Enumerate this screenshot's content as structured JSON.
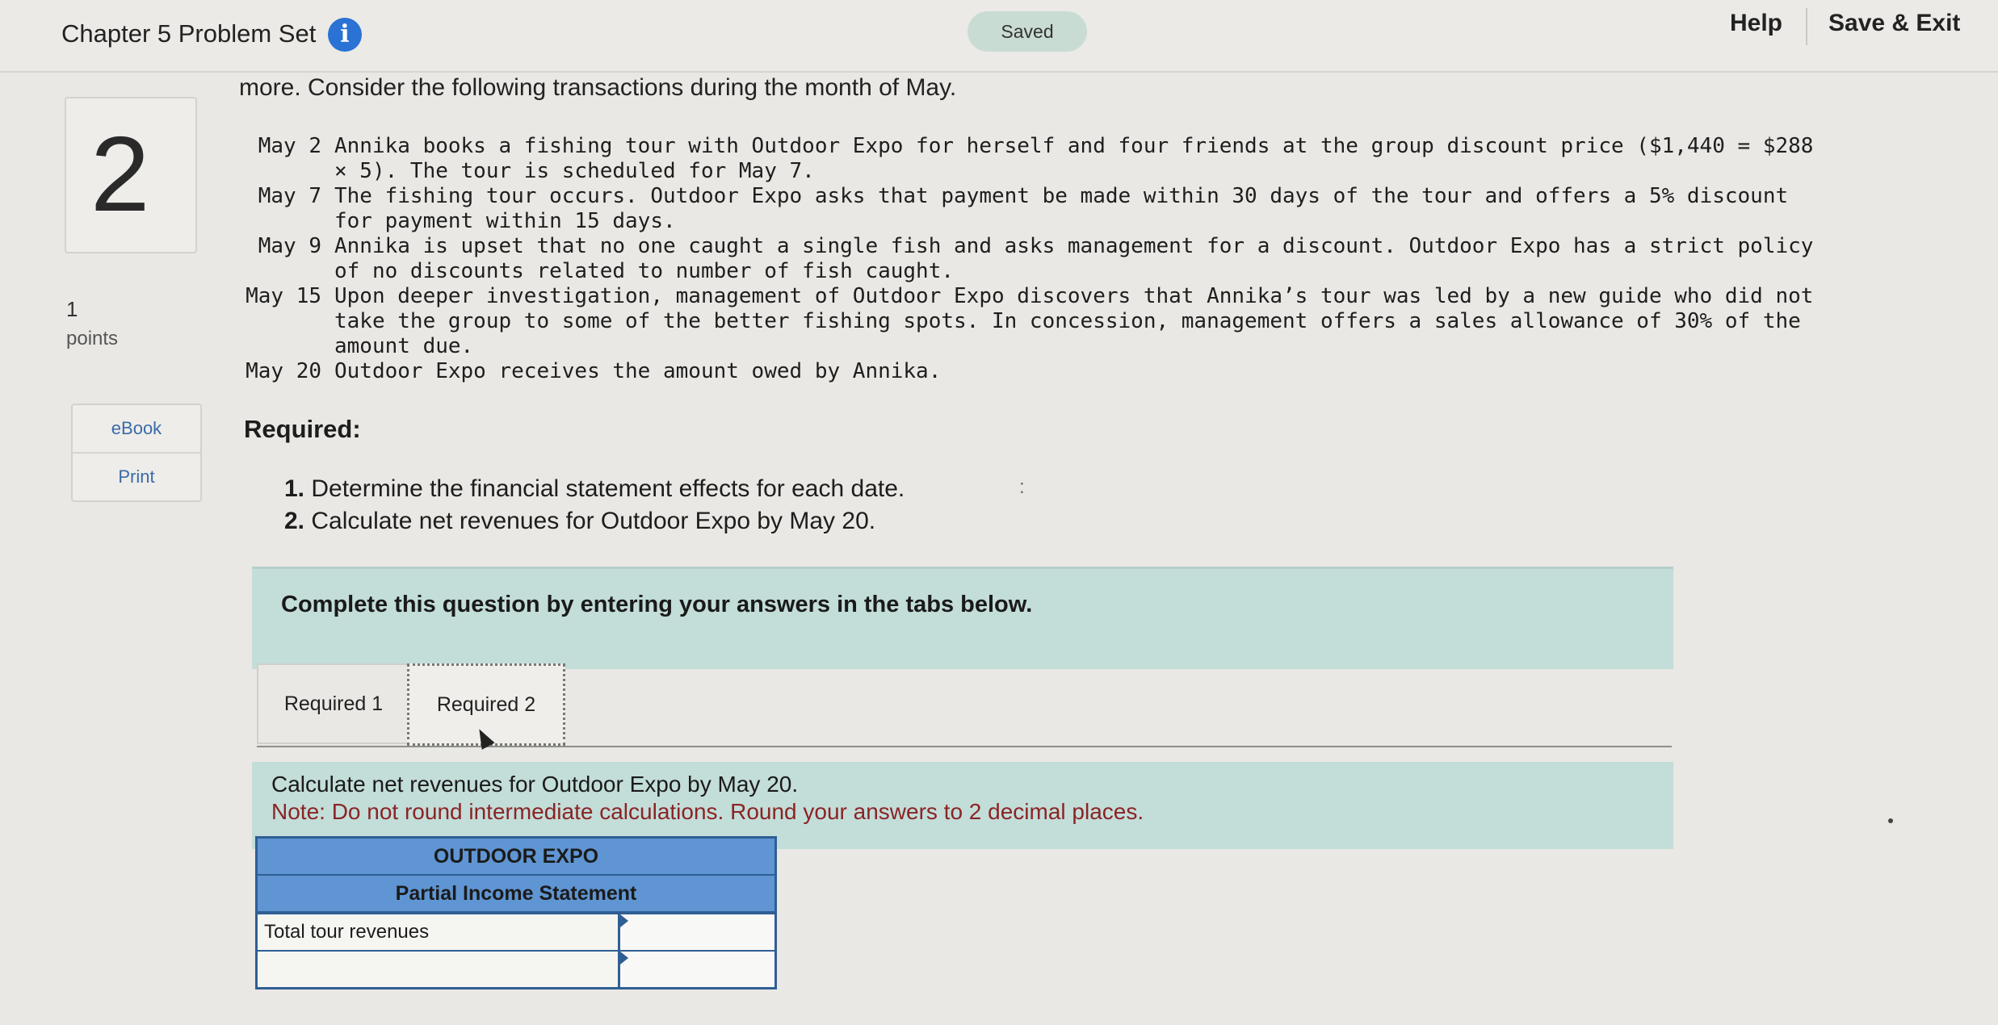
{
  "header": {
    "title": "Chapter 5 Problem Set",
    "info_icon": "i",
    "saved": "Saved",
    "help": "Help",
    "save_exit": "Save & Exit"
  },
  "sidebar": {
    "question_number": "2",
    "points_value": "1",
    "points_label": "points",
    "buttons": [
      "eBook",
      "Print"
    ]
  },
  "problem": {
    "intro": "more. Consider the following transactions during the month of May.",
    "transactions": [
      {
        "date": "May 2",
        "text": "Annika books a fishing tour with Outdoor Expo for herself and four friends at the group discount price ($1,440 = $288 × 5). The tour is scheduled for May 7."
      },
      {
        "date": "May 7",
        "text": "The fishing tour occurs. Outdoor Expo asks that payment be made within 30 days of the tour and offers a 5% discount for payment within 15 days."
      },
      {
        "date": "May 9",
        "text": "Annika is upset that no one caught a single fish and asks management for a discount. Outdoor Expo has a strict policy of no discounts related to number of fish caught."
      },
      {
        "date": "May 15",
        "text": "Upon deeper investigation, management of Outdoor Expo discovers that Annika’s tour was led by a new guide who did not take the group to some of the better fishing spots. In concession, management offers a sales allowance of 30% of the amount due."
      },
      {
        "date": "May 20",
        "text": "Outdoor Expo receives the amount owed by Annika."
      }
    ],
    "required_heading": "Required:",
    "requirements": [
      {
        "num": "1.",
        "text": "Determine the financial statement effects for each date."
      },
      {
        "num": "2.",
        "text": "Calculate net revenues for Outdoor Expo by May 20."
      }
    ],
    "stray_mark": ":"
  },
  "instructions": "Complete this question by entering your answers in the tabs below.",
  "tabs": [
    "Required 1",
    "Required 2"
  ],
  "active_tab": "Required 2",
  "tab_content": {
    "prompt": "Calculate net revenues for Outdoor Expo by May 20.",
    "note": "Note: Do not round intermediate calculations. Round your answers to 2 decimal places."
  },
  "statement": {
    "company": "OUTDOOR EXPO",
    "title": "Partial Income Statement",
    "rows": [
      {
        "label": "Total tour revenues",
        "value": ""
      },
      {
        "label": "",
        "value": ""
      }
    ]
  }
}
